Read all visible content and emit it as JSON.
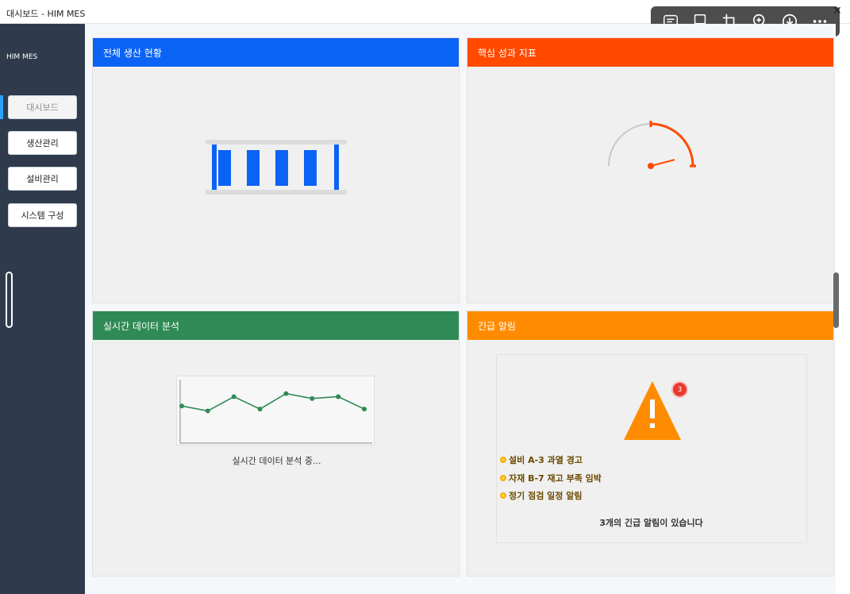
{
  "window": {
    "title": "대시보드 - HIM MES"
  },
  "viewer_toolbar": {
    "icons": [
      "comment-icon",
      "caption-icon",
      "crop-icon",
      "zoom-in-icon",
      "download-icon",
      "more-icon"
    ],
    "close": "✕"
  },
  "sidebar": {
    "brand": "HIM MES",
    "items": [
      {
        "label": "대시보드",
        "active": true
      },
      {
        "label": "생산관리",
        "active": false
      },
      {
        "label": "설비관리",
        "active": false
      },
      {
        "label": "시스템 구성",
        "active": false
      }
    ]
  },
  "panels": {
    "production": {
      "title": "전체 생산 현황",
      "color": "#0a63f5"
    },
    "kpi": {
      "title": "핵심 성과 지표",
      "color": "#ff4a00",
      "gauge_fraction": 0.77
    },
    "realtime": {
      "title": "실시간 데이터 분석",
      "color": "#2f8a55",
      "caption": "실시간 데이터 분석 중...",
      "line_color": "#2f8a55"
    },
    "alerts": {
      "title": "긴급 알림",
      "color": "#ff8c00",
      "badge": "3",
      "warning_icon": "warning-triangle-icon",
      "items": [
        "설비 A-3 과열 경고",
        "자재 B-7 재고 부족 임박",
        "정기 점검 일정 알림"
      ],
      "summary": "3개의 긴급 알림이 있습니다"
    }
  },
  "chart_data": {
    "type": "line",
    "x": [
      1,
      2,
      3,
      4,
      5,
      6,
      7,
      8
    ],
    "series": [
      {
        "values": [
          60,
          52,
          75,
          55,
          80,
          72,
          75,
          55
        ]
      }
    ],
    "ylim": [
      0,
      100
    ]
  }
}
